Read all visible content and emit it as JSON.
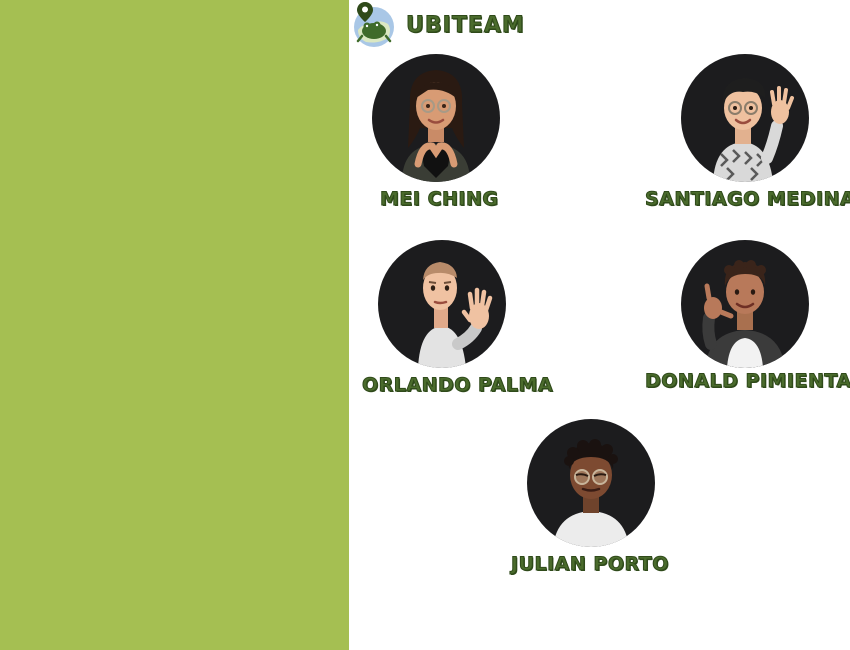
{
  "brand": {
    "name": "UBITEAM",
    "logo_icon": "frog-location-pin-logo-icon"
  },
  "colors": {
    "sidebar": "#a5bf52",
    "name_text": "#4a6b2c",
    "avatar_bg": "#1c1c1e"
  },
  "team": [
    {
      "name": "MEI CHING",
      "avatar_icon": "memoji-woman-heart-hands-icon"
    },
    {
      "name": "SANTIAGO MEDINA",
      "avatar_icon": "memoji-man-waving-glasses-icon"
    },
    {
      "name": "ORLANDO PALMA",
      "avatar_icon": "memoji-man-raised-hand-icon"
    },
    {
      "name": "DONALD PIMIENTA",
      "avatar_icon": "memoji-man-call-me-gesture-icon"
    },
    {
      "name": "JULIAN PORTO",
      "avatar_icon": "memoji-man-curly-hair-glasses-icon"
    }
  ]
}
